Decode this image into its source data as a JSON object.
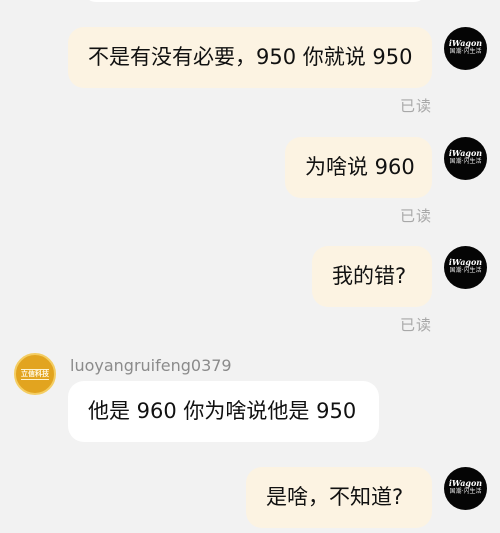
{
  "my_avatar": {
    "logo_top": "iWagon",
    "logo_bottom": "国潮·闪生活"
  },
  "other_user": {
    "username": "luoyangruifeng0379",
    "avatar_text": "立信科技"
  },
  "messages": [
    {
      "direction": "out",
      "text": "不是有没有必要，950 你就说 950",
      "status": "已读"
    },
    {
      "direction": "out",
      "text": "为啥说 960",
      "status": "已读"
    },
    {
      "direction": "out",
      "text": "我的错?",
      "status": "已读"
    },
    {
      "direction": "in",
      "text": "他是 960  你为啥说他是 950"
    },
    {
      "direction": "out",
      "text": "是啥，不知道?"
    }
  ]
}
